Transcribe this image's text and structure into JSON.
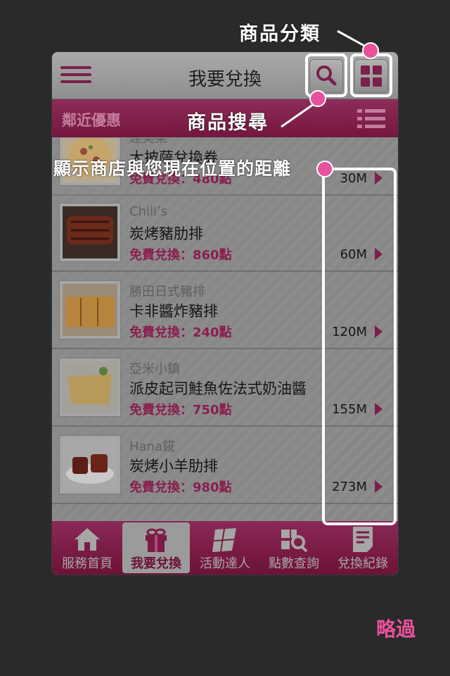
{
  "header": {
    "title": "我要兌換"
  },
  "subheader": {
    "title": "鄰近優惠"
  },
  "items": [
    {
      "store": "達美樂",
      "dish": "大披薩兌換券",
      "points": "免費兌換：480點",
      "distance": "30M"
    },
    {
      "store": "Chili’s",
      "dish": "炭烤豬肋排",
      "points": "免費兌換：860點",
      "distance": "60M"
    },
    {
      "store": "勝田日式豬排",
      "dish": "卡非醬炸豬排",
      "points": "免費兌換：240點",
      "distance": "120M"
    },
    {
      "store": "亞米小鎮",
      "dish": "派皮起司鮭魚佐法式奶油醬",
      "points": "免費兌換：750點",
      "distance": "155M"
    },
    {
      "store": "Hana錵",
      "dish": "炭烤小羊肋排",
      "points": "免費兌換：980點",
      "distance": "273M"
    }
  ],
  "tabs": [
    {
      "label": "服務首頁",
      "icon": "home-icon"
    },
    {
      "label": "我要兌換",
      "icon": "gift-icon",
      "active": true
    },
    {
      "label": "活動達人",
      "icon": "flag-icon"
    },
    {
      "label": "點數查詢",
      "icon": "search-grid-icon"
    },
    {
      "label": "兌換紀錄",
      "icon": "receipt-icon"
    }
  ],
  "annotations": {
    "category": "商品分類",
    "search": "商品搜尋",
    "distance": "顯示商店與您現在位置的距離"
  },
  "skip_label": "略過",
  "colors": {
    "accent": "#8a1e4f",
    "annotation_dot": "#e8529c",
    "overlay": "#2a2a2a"
  }
}
